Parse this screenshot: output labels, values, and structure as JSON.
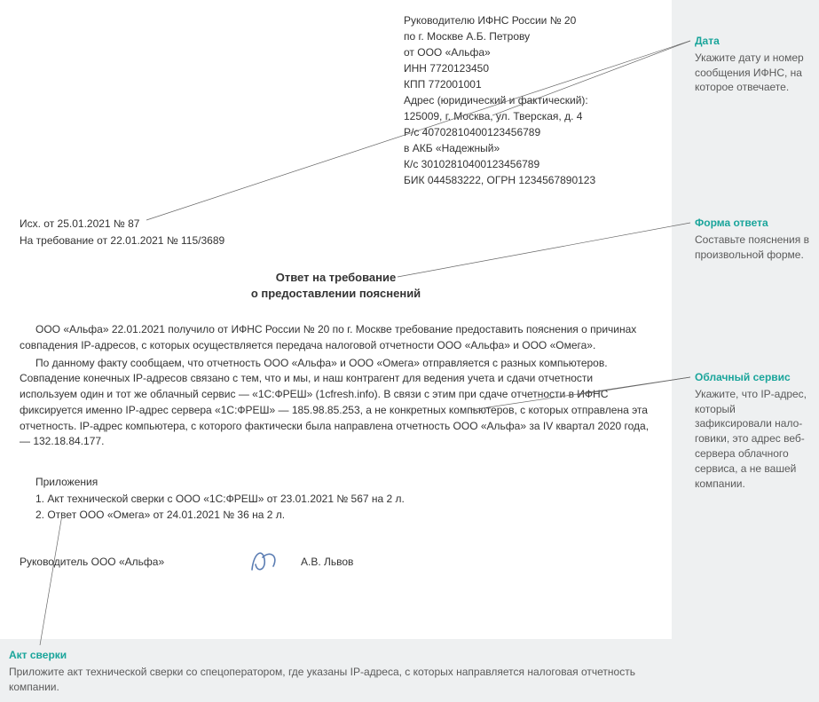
{
  "header": {
    "l1": "Руководителю ИФНС России № 20",
    "l2": "по г. Москве А.Б. Петрову",
    "l3": "от ООО «Альфа»",
    "l4": "ИНН 7720123450",
    "l5": "КПП 772001001",
    "l6": "Адрес (юридический и фактический):",
    "l7": "125009, г. Москва, ул. Тверская, д. 4",
    "l8": "Р/с 40702810400123456789",
    "l9": "в АКБ «Надежный»",
    "l10": "К/с 30102810400123456789",
    "l11": "БИК 044583222, ОГРН 1234567890123"
  },
  "outgoing": {
    "l1": "Исх. от 25.01.2021 № 87",
    "l2": "На требование от 22.01.2021 № 115/3689"
  },
  "title": {
    "l1": "Ответ на требование",
    "l2": "о предоставлении пояснений"
  },
  "body": {
    "p1": "ООО «Альфа» 22.01.2021 получило от ИФНС России № 20 по г. Москве требование предоставить пояснения о причинах совпадения IP-адресов, с которых осуществляется передача налоговой отчетности ООО «Альфа» и ООО «Омега».",
    "p2": "По данному факту сообщаем, что отчетность ООО «Альфа» и ООО «Омега» отправляется с разных компьютеров. Совпадение конечных IP-адресов связано с тем, что и мы, и наш контрагент для ведения учета и сдачи отчетности используем один и тот же облачный сервис — «1С:ФРЕШ» (1cfresh.info). В связи с этим при сдаче отчетности в ИФНС фиксируется именно IP-адрес сервера «1С:ФРЕШ» — 185.98.85.253, а не конкретных компьютеров, с которых отправлена эта отчетность. IP-адрес компьютера, с которого фактически была направлена отчетность ООО «Альфа» за IV квартал 2020 года, — 132.18.84.177."
  },
  "attachments": {
    "title": "Приложения",
    "l1": "1. Акт технической сверки с ООО «1С:ФРЕШ» от 23.01.2021 № 567 на 2 л.",
    "l2": "2. Ответ ООО «Омега» от 24.01.2021 № 36 на 2 л."
  },
  "signature": {
    "role": "Руководитель ООО «Альфа»",
    "name": "А.В. Львов"
  },
  "callouts": {
    "date": {
      "title": "Дата",
      "text": "Укажите дату и номер сообщения ИФНС, на которое отвечаете."
    },
    "form": {
      "title": "Форма ответа",
      "text": "Составьте пояснения в произвольной форме."
    },
    "cloud": {
      "title": "Облачный сервис",
      "text": "Укажите, что IP-адрес, который зафиксировали нало­говики, это адрес веб-сервера облачного сервиса, а не вашей компании."
    },
    "act": {
      "title": "Акт сверки",
      "text": "Приложите акт технической сверки со спецоператором, где указаны IP-адреса, с которых направляется налоговая отчетность компании."
    }
  }
}
